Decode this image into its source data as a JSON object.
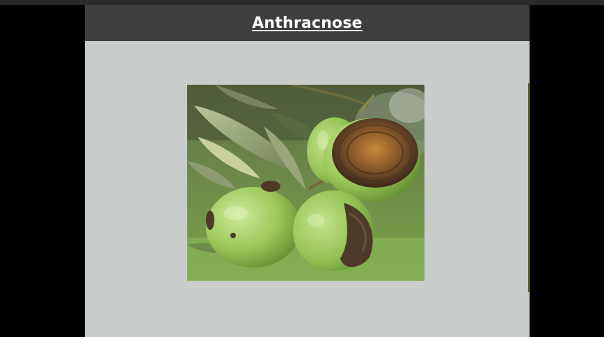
{
  "slide": {
    "title": "Anthracnose"
  },
  "image": {
    "subject": "olive-fruits-anthracnose-photo",
    "colors": {
      "fruit": "#9ccc5a",
      "lesion": "#6b4a2a",
      "leaf": "#7b8a5a",
      "background": "#4f6a2f"
    }
  },
  "colors": {
    "page_background": "#000000",
    "slide_background": "#c8cccb",
    "title_bar": "#3e3e3e",
    "title_text": "#ffffff"
  }
}
